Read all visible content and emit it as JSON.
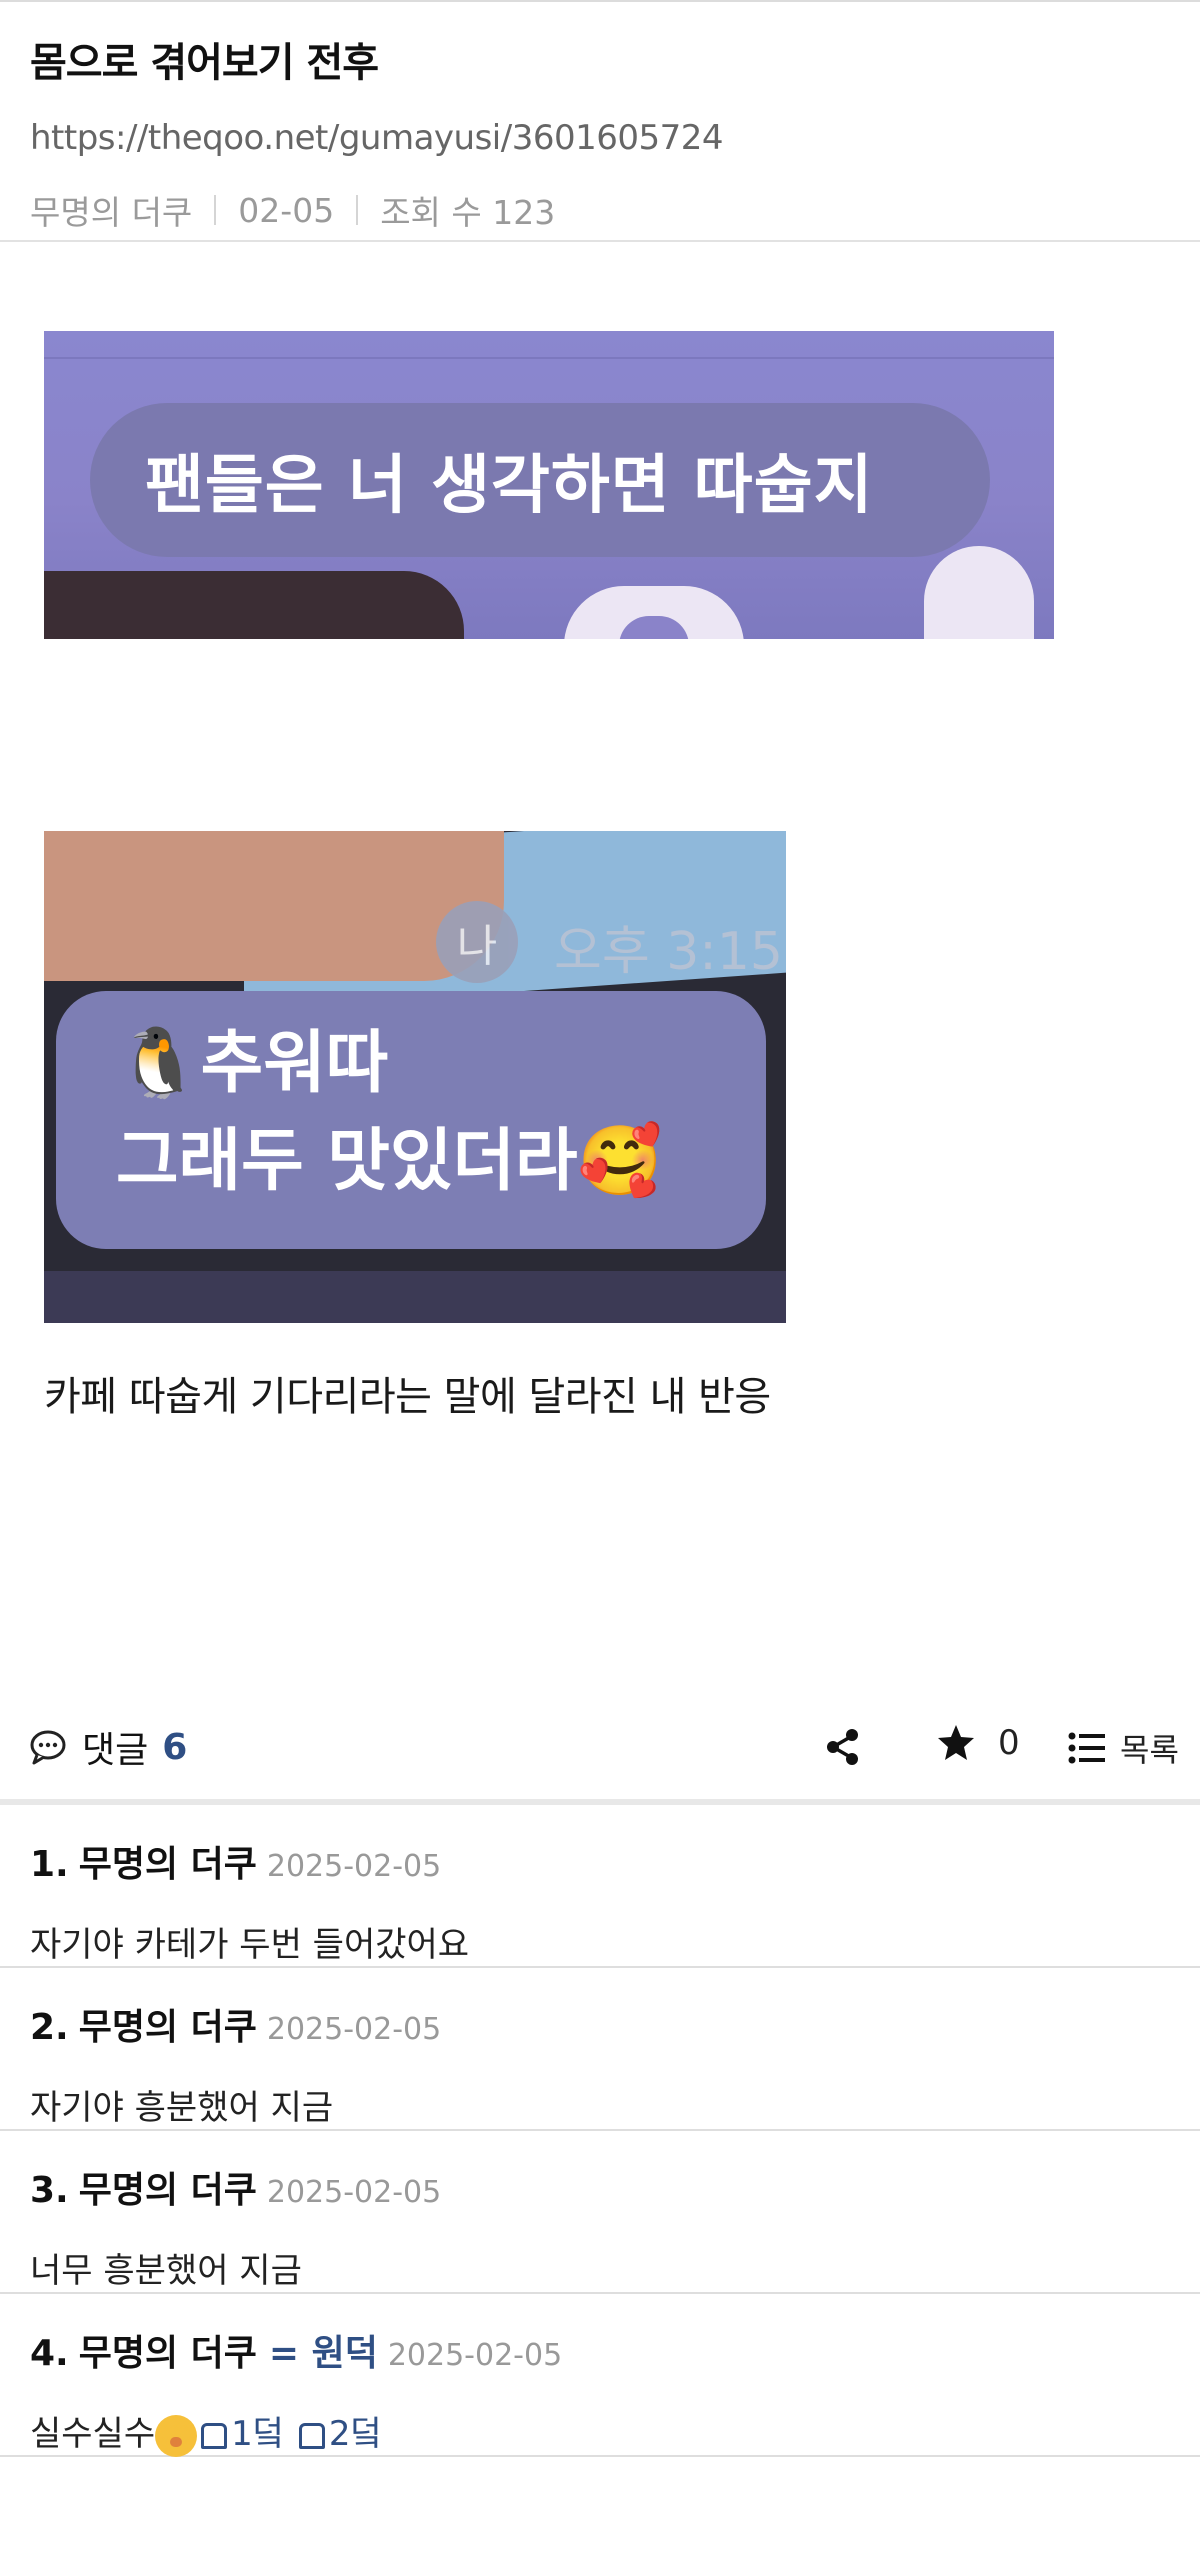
{
  "post": {
    "title": "몸으로 겪어보기 전후",
    "url": "https://theqoo.net/gumayusi/3601605724",
    "author": "무명의 더쿠",
    "date": "02-05",
    "views_label": "조회 수 123"
  },
  "images": [
    {
      "caption_text": "팬들은 너 생각하면 따숩지"
    },
    {
      "badge": "나",
      "time": "오후 3:15",
      "line1": "🐧추워따",
      "line2": "그래두 맛있더라🥰"
    }
  ],
  "body_text": "카페 따숩게 기다리라는 말에 달라진 내 반응",
  "actions": {
    "comments_label": "댓글",
    "comments_count": "6",
    "star_count": "0",
    "list_label": "목록",
    "icons": [
      "comment-icon",
      "share-icon",
      "star-icon",
      "list-icon"
    ]
  },
  "comments": [
    {
      "num": "1.",
      "author": "무명의 더쿠",
      "tag": "",
      "date": "2025-02-05",
      "text": "자기야 카테가 두번 들어갔어요"
    },
    {
      "num": "2.",
      "author": "무명의 더쿠",
      "tag": "",
      "date": "2025-02-05",
      "text": "자기야 흥분했어 지금"
    },
    {
      "num": "3.",
      "author": "무명의 더쿠",
      "tag": "",
      "date": "2025-02-05",
      "text": "너무 흥분했어 지금"
    },
    {
      "num": "4.",
      "author": "무명의 더쿠",
      "tag": "= 원덕",
      "date": "2025-02-05",
      "text": "실수실수",
      "extra1": "1덬",
      "extra2": "2덬"
    }
  ]
}
